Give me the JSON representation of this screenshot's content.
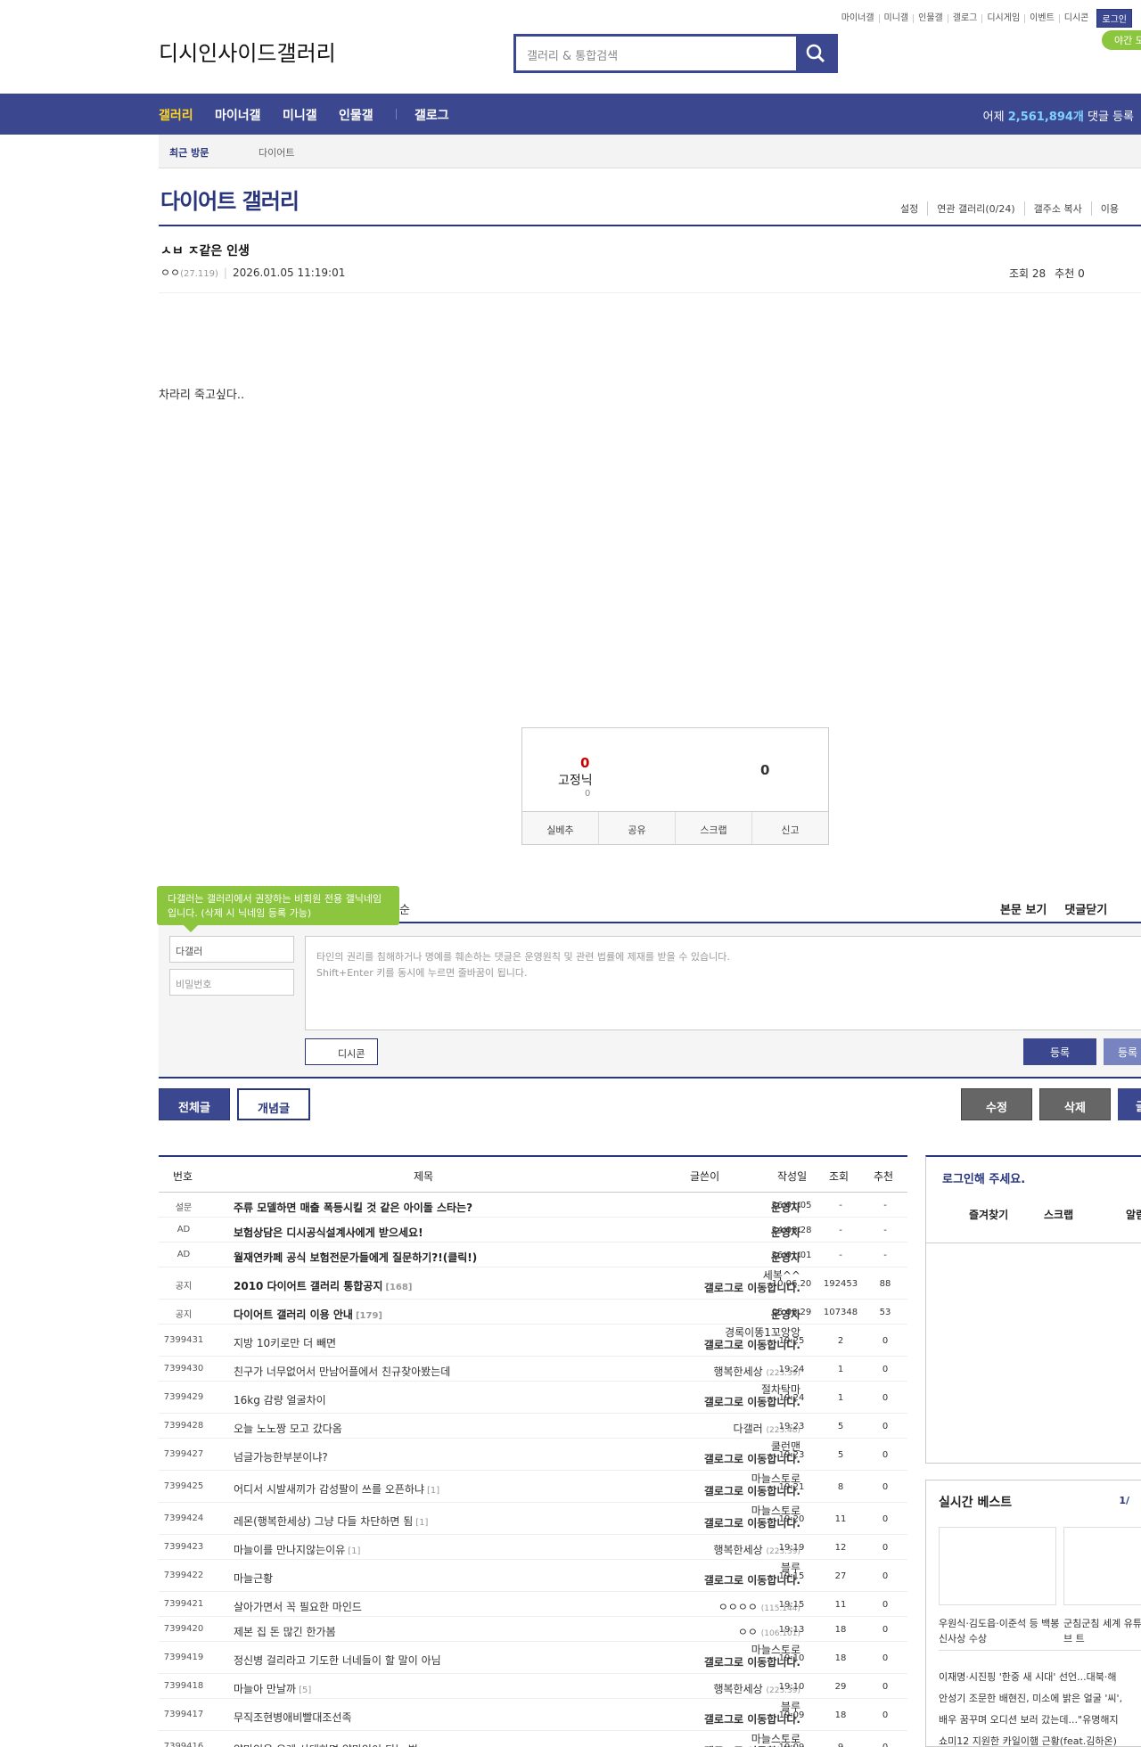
{
  "top_links": [
    "마이너갤",
    "미니갤",
    "인물갤",
    "갤로그",
    "디시게임",
    "이벤트",
    "디시콘"
  ],
  "login_label": "로그인",
  "night_mode_label": "야간 모드",
  "logo": {
    "site": "디시인사이드",
    "gallery": "갤러리"
  },
  "search": {
    "placeholder": "갤러리 & 통합검색"
  },
  "gnb": {
    "items": [
      "갤러리",
      "마이너갤",
      "미니갤",
      "인물갤",
      "갤로그"
    ],
    "count_prefix": "어제",
    "count_value": "2,561,894개",
    "count_suffix": "댓글 등록"
  },
  "recent": {
    "label": "최근 방문",
    "item": "다이어트"
  },
  "gallery": {
    "title": "다이어트 갤러리",
    "menu": [
      "설정",
      "연관 갤러리(0/24)",
      "갤주소 복사",
      "이용"
    ]
  },
  "post": {
    "title": "ㅅㅂ ㅈ같은 인생",
    "author": "ㅇㅇ",
    "author_ip": "(27.119)",
    "date": "2026.01.05 11:19:01",
    "views_label": "조회 28",
    "recommend_label": "추천 0",
    "body": "차라리 죽고싶다.."
  },
  "recommend": {
    "up": "0",
    "fixed_label": "고정닉",
    "fixed_count": "0",
    "down": "0",
    "buttons": [
      "실베추",
      "공유",
      "스크랩",
      "신고"
    ]
  },
  "comment": {
    "tooltip": "다갤러는 갤러리에서 권장하는 비회원 전용 갤닉네임입니다. (삭제 시 닉네임 등록 가능)",
    "header_suffix": "순",
    "links": [
      "본문 보기",
      "댓글닫기"
    ],
    "nickname": "다갤러",
    "password_placeholder": "비밀번호",
    "notice_line1": "타인의 권리를 침해하거나 명예를 훼손하는 댓글은 운영원칙 및 관련 법률에 제재를 받을 수 있습니다.",
    "notice_line2": "Shift+Enter 키를 동시에 누르면 줄바꿈이 됩니다.",
    "dccon_label": "디시콘",
    "submit_label": "등록",
    "submit2_label": "등록"
  },
  "board_buttons": {
    "all": "전체글",
    "concept": "개념글",
    "edit": "수정",
    "delete": "삭제",
    "write": "글"
  },
  "table": {
    "headers": [
      "번호",
      "제목",
      "글쓴이",
      "작성일",
      "조회",
      "추천"
    ],
    "gallog_text": "갤로그로 이동합니다.",
    "rows": [
      {
        "no": "설문",
        "title": "주류 모델하면 매출 폭등시킬 것 같은 아이돌 스타는?",
        "bold": true,
        "writer": "운영자",
        "writer_bold": true,
        "date": "26/01/05",
        "views": "-",
        "rec": "-"
      },
      {
        "no": "AD",
        "title": "보험상담은 디시공식설계사에게 받으세요!",
        "bold": true,
        "writer": "운영자",
        "writer_bold": true,
        "date": "24/08/28",
        "views": "-",
        "rec": "-"
      },
      {
        "no": "AD",
        "title": "월재연카페 공식 보험전문가들에게 질문하기?!(클릭!)",
        "bold": true,
        "writer": "운영자",
        "writer_bold": true,
        "date": "26/01/01",
        "views": "-",
        "rec": "-"
      },
      {
        "no": "공지",
        "title": "2010 다이어트 갤러리 통합공지",
        "reply": "[168]",
        "bold": true,
        "writer": "세복^^",
        "gallog": true,
        "date": "10.06.20",
        "views": "192453",
        "rec": "88"
      },
      {
        "no": "공지",
        "title": "다이어트 갤러리 이용 안내",
        "reply": "[179]",
        "bold": true,
        "writer": "운영자",
        "writer_bold": true,
        "date": "05.08.29",
        "views": "107348",
        "rec": "53"
      },
      {
        "no": "7399431",
        "title": "지방 10키로만 더 빼면",
        "writer": "경록이똥1꼬앙앙",
        "gallog": true,
        "date": "19:25",
        "views": "2",
        "rec": "0"
      },
      {
        "no": "7399430",
        "title": "친구가 너무없어서 만남어플에서 친규찾아봤는데",
        "writer": "행복한세상",
        "ip": "(223.39)",
        "date": "19:24",
        "views": "1",
        "rec": "0"
      },
      {
        "no": "7399429",
        "title": "16kg 감량 얼굴차이",
        "writer": "절차탁마",
        "gallog": true,
        "date": "19:24",
        "views": "1",
        "rec": "0"
      },
      {
        "no": "7399428",
        "title": "오늘 노노짱 모고 갔다옴",
        "writer": "다갤러",
        "ip": "(223.48)",
        "date": "19:23",
        "views": "5",
        "rec": "0"
      },
      {
        "no": "7399427",
        "title": "넘글가능한부분이냐?",
        "writer": "쿨런맨",
        "gallog": true,
        "date": "19:23",
        "views": "5",
        "rec": "0"
      },
      {
        "no": "7399425",
        "title": "어디서 시발새끼가 감성팔이 쓰를 오픈하냐",
        "reply": "[1]",
        "writer": "마늘스토로",
        "gallog": true,
        "date": "19:21",
        "views": "8",
        "rec": "0"
      },
      {
        "no": "7399424",
        "title": "레몬(행복한세상) 그냥 다들 차단하면 됨",
        "reply": "[1]",
        "writer": "마늘스토로",
        "gallog": true,
        "date": "19:20",
        "views": "11",
        "rec": "0"
      },
      {
        "no": "7399423",
        "title": "마늘이를 만나지않는이유",
        "reply": "[1]",
        "writer": "행복한세상",
        "ip": "(223.39)",
        "date": "19:19",
        "views": "12",
        "rec": "0"
      },
      {
        "no": "7399422",
        "title": "마늘근황",
        "writer": "블루",
        "gallog": true,
        "date": "19:15",
        "views": "27",
        "rec": "0"
      },
      {
        "no": "7399421",
        "title": "살아가면서 꼭 필요한 마인드",
        "writer": "ㅇㅇㅇㅇ",
        "ip": "(115.144)",
        "date": "19:15",
        "views": "11",
        "rec": "0"
      },
      {
        "no": "7399420",
        "title": "제본 집 돈 많긴 한가봄",
        "writer": "ㅇㅇ",
        "ip": "(106.101)",
        "date": "19:13",
        "views": "18",
        "rec": "0"
      },
      {
        "no": "7399419",
        "title": "정신병 걸리라고 기도한 너네들이 할 말이 아님",
        "writer": "마늘스토로",
        "gallog": true,
        "date": "19:10",
        "views": "18",
        "rec": "0"
      },
      {
        "no": "7399418",
        "title": "마늘아 만날까",
        "reply": "[5]",
        "writer": "행복한세상",
        "ip": "(223.39)",
        "date": "19:10",
        "views": "29",
        "rec": "0"
      },
      {
        "no": "7399417",
        "title": "무직조현병애비빨대조선족",
        "writer": "블루",
        "gallog": true,
        "date": "19:09",
        "views": "18",
        "rec": "0"
      },
      {
        "no": "7399416",
        "title": "양마인을 우레 사대하면 양마인이 되는 법",
        "writer": "마늘스토로",
        "gallog": true,
        "date": "19:09",
        "views": "9",
        "rec": "0"
      }
    ]
  },
  "sidebar": {
    "login_prompt": "로그인해 주세요.",
    "links": [
      "즐겨찾기",
      "스크랩",
      "알림"
    ],
    "best_title": "실시간 베스트",
    "best_page": "1/",
    "best_caps": [
      "우원식·김도읍·이준석 등 백봉신사상 수상",
      "군침군침 세계 유튜브 트"
    ],
    "best_lines": [
      "이재명·시진핑 '한중 새 시대' 선언...대북·해",
      "안성기 조문한 배현진, 미소에 밝은 얼굴 '씨', ",
      "배우 꿈꾸며 오디션 보러 갔는데...\"유명해지",
      "쇼미12 지원한 카일이햄 근황(feat.김하온)"
    ]
  },
  "colors": {
    "primary": "#3b4890",
    "dark": "#29367c",
    "accent_yellow": "#ffd51f",
    "green": "#8cc63f",
    "button_gray": "#666666"
  }
}
